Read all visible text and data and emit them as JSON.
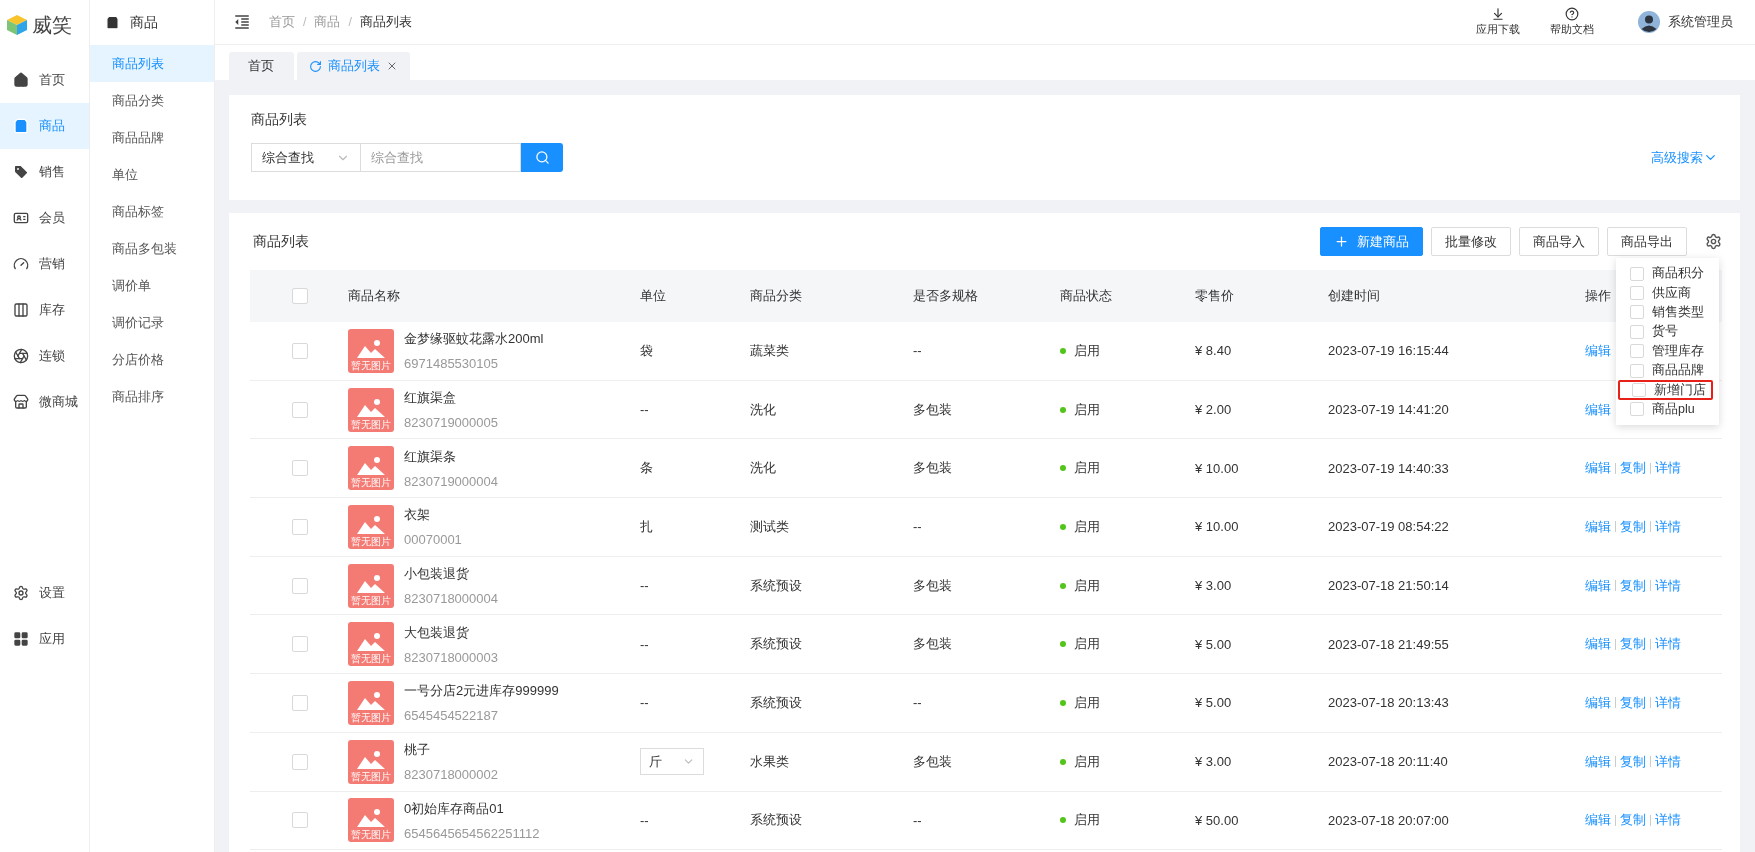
{
  "logo": {
    "text": "威笑"
  },
  "nav": [
    {
      "kind": "home",
      "label": "首页",
      "selected": false
    },
    {
      "kind": "bag",
      "label": "商品",
      "selected": true
    },
    {
      "kind": "tag",
      "label": "销售",
      "selected": false
    },
    {
      "kind": "card",
      "label": "会员",
      "selected": false
    },
    {
      "kind": "gauge",
      "label": "营销",
      "selected": false
    },
    {
      "kind": "stock",
      "label": "库存",
      "selected": false
    },
    {
      "kind": "chain",
      "label": "连锁",
      "selected": false
    },
    {
      "kind": "store",
      "label": "微商城",
      "selected": false
    }
  ],
  "nav_bottom": [
    {
      "kind": "gear",
      "label": "设置",
      "selected": false
    },
    {
      "kind": "grid",
      "label": "应用",
      "selected": false
    }
  ],
  "submenu": {
    "title": "商品",
    "items": [
      {
        "label": "商品列表",
        "selected": true
      },
      {
        "label": "商品分类",
        "selected": false
      },
      {
        "label": "商品品牌",
        "selected": false
      },
      {
        "label": "单位",
        "selected": false
      },
      {
        "label": "商品标签",
        "selected": false
      },
      {
        "label": "商品多包装",
        "selected": false
      },
      {
        "label": "调价单",
        "selected": false
      },
      {
        "label": "调价记录",
        "selected": false
      },
      {
        "label": "分店价格",
        "selected": false
      },
      {
        "label": "商品排序",
        "selected": false
      }
    ]
  },
  "breadcrumb": [
    "首页",
    "商品",
    "商品列表"
  ],
  "breadcrumb_separator": "/",
  "header_actions": [
    {
      "kind": "download",
      "label": "应用下载"
    },
    {
      "kind": "help",
      "label": "帮助文档"
    }
  ],
  "user": {
    "name": "系统管理员"
  },
  "tabs": [
    {
      "label": "首页",
      "selected": false,
      "closable": false
    },
    {
      "label": "商品列表",
      "selected": true,
      "closable": true
    }
  ],
  "search": {
    "title": "商品列表",
    "select_value": "综合查找",
    "placeholder": "综合查找",
    "advanced": "高级搜索"
  },
  "list": {
    "title": "商品列表",
    "buttons": [
      {
        "label": "新建商品",
        "primary": true
      },
      {
        "label": "批量修改",
        "primary": false
      },
      {
        "label": "商品导入",
        "primary": false
      },
      {
        "label": "商品导出",
        "primary": false
      }
    ]
  },
  "column_picker": [
    {
      "label": "商品积分",
      "checked": false,
      "highlighted": false
    },
    {
      "label": "供应商",
      "checked": false,
      "highlighted": false
    },
    {
      "label": "销售类型",
      "checked": false,
      "highlighted": false
    },
    {
      "label": "货号",
      "checked": false,
      "highlighted": false
    },
    {
      "label": "管理库存",
      "checked": false,
      "highlighted": false
    },
    {
      "label": "商品品牌",
      "checked": false,
      "highlighted": false
    },
    {
      "label": "新增门店",
      "checked": false,
      "highlighted": true
    },
    {
      "label": "商品plu",
      "checked": false,
      "highlighted": false
    }
  ],
  "table": {
    "all_checked": false,
    "columns": [
      "商品名称",
      "单位",
      "商品分类",
      "是否多规格",
      "商品状态",
      "零售价",
      "创建时间",
      "操作"
    ],
    "rows": [
      {
        "checked": false,
        "image_text": "暂无图片",
        "name": "金梦缘驱蚊花露水200ml",
        "code": "6971485530105",
        "unit": {
          "kind": "text",
          "value": "袋"
        },
        "category": "蔬菜类",
        "multi": "--",
        "status": "启用",
        "price": "¥ 8.40",
        "created": "2023-07-19 16:15:44",
        "actions": [
          "编辑"
        ]
      },
      {
        "checked": false,
        "image_text": "暂无图片",
        "name": "红旗渠盒",
        "code": "8230719000005",
        "unit": {
          "kind": "text",
          "value": "--"
        },
        "category": "洗化",
        "multi": "多包装",
        "status": "启用",
        "price": "¥ 2.00",
        "created": "2023-07-19 14:41:20",
        "actions": [
          "编辑"
        ]
      },
      {
        "checked": false,
        "image_text": "暂无图片",
        "name": "红旗渠条",
        "code": "8230719000004",
        "unit": {
          "kind": "text",
          "value": "条"
        },
        "category": "洗化",
        "multi": "多包装",
        "status": "启用",
        "price": "¥ 10.00",
        "created": "2023-07-19 14:40:33",
        "actions": [
          "编辑",
          "复制",
          "详情"
        ]
      },
      {
        "checked": false,
        "image_text": "暂无图片",
        "name": "衣架",
        "code": "00070001",
        "unit": {
          "kind": "text",
          "value": "扎"
        },
        "category": "测试类",
        "multi": "--",
        "status": "启用",
        "price": "¥ 10.00",
        "created": "2023-07-19 08:54:22",
        "actions": [
          "编辑",
          "复制",
          "详情"
        ]
      },
      {
        "checked": false,
        "image_text": "暂无图片",
        "name": "小包装退货",
        "code": "8230718000004",
        "unit": {
          "kind": "text",
          "value": "--"
        },
        "category": "系统预设",
        "multi": "多包装",
        "status": "启用",
        "price": "¥ 3.00",
        "created": "2023-07-18 21:50:14",
        "actions": [
          "编辑",
          "复制",
          "详情"
        ]
      },
      {
        "checked": false,
        "image_text": "暂无图片",
        "name": "大包装退货",
        "code": "8230718000003",
        "unit": {
          "kind": "text",
          "value": "--"
        },
        "category": "系统预设",
        "multi": "多包装",
        "status": "启用",
        "price": "¥ 5.00",
        "created": "2023-07-18 21:49:55",
        "actions": [
          "编辑",
          "复制",
          "详情"
        ]
      },
      {
        "checked": false,
        "image_text": "暂无图片",
        "name": "一号分店2元进库存999999",
        "code": "6545454522187",
        "unit": {
          "kind": "text",
          "value": "--"
        },
        "category": "系统预设",
        "multi": "--",
        "status": "启用",
        "price": "¥ 5.00",
        "created": "2023-07-18 20:13:43",
        "actions": [
          "编辑",
          "复制",
          "详情"
        ]
      },
      {
        "checked": false,
        "image_text": "暂无图片",
        "name": "桃子",
        "code": "8230718000002",
        "unit": {
          "kind": "select",
          "value": "斤"
        },
        "category": "水果类",
        "multi": "多包装",
        "status": "启用",
        "price": "¥ 3.00",
        "created": "2023-07-18 20:11:40",
        "actions": [
          "编辑",
          "复制",
          "详情"
        ]
      },
      {
        "checked": false,
        "image_text": "暂无图片",
        "name": "0初始库存商品01",
        "code": "6545645654562251112",
        "unit": {
          "kind": "text",
          "value": "--"
        },
        "category": "系统预设",
        "multi": "--",
        "status": "启用",
        "price": "¥ 50.00",
        "created": "2023-07-18 20:07:00",
        "actions": [
          "编辑",
          "复制",
          "详情"
        ]
      }
    ]
  }
}
